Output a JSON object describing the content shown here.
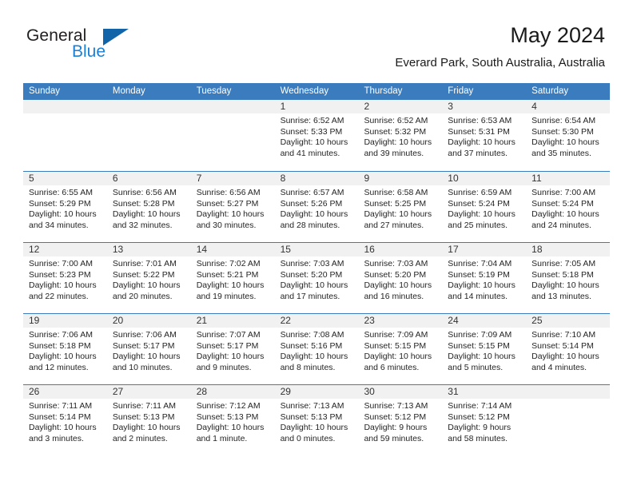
{
  "brand": {
    "name_part1": "General",
    "name_part2": "Blue",
    "triangle_color": "#1264a8",
    "blue_text_color": "#1b7fd4"
  },
  "header": {
    "title": "May 2024",
    "location": "Everard Park, South Australia, Australia"
  },
  "theme": {
    "header_band": "#3a7cbe",
    "day_band": "#f1f1f1",
    "text": "#1a1a1a"
  },
  "weekdays": [
    "Sunday",
    "Monday",
    "Tuesday",
    "Wednesday",
    "Thursday",
    "Friday",
    "Saturday"
  ],
  "weeks": [
    [
      {
        "day": "",
        "sunrise": "",
        "sunset": "",
        "daylight_line1": "",
        "daylight_line2": ""
      },
      {
        "day": "",
        "sunrise": "",
        "sunset": "",
        "daylight_line1": "",
        "daylight_line2": ""
      },
      {
        "day": "",
        "sunrise": "",
        "sunset": "",
        "daylight_line1": "",
        "daylight_line2": ""
      },
      {
        "day": "1",
        "sunrise": "Sunrise: 6:52 AM",
        "sunset": "Sunset: 5:33 PM",
        "daylight_line1": "Daylight: 10 hours",
        "daylight_line2": "and 41 minutes."
      },
      {
        "day": "2",
        "sunrise": "Sunrise: 6:52 AM",
        "sunset": "Sunset: 5:32 PM",
        "daylight_line1": "Daylight: 10 hours",
        "daylight_line2": "and 39 minutes."
      },
      {
        "day": "3",
        "sunrise": "Sunrise: 6:53 AM",
        "sunset": "Sunset: 5:31 PM",
        "daylight_line1": "Daylight: 10 hours",
        "daylight_line2": "and 37 minutes."
      },
      {
        "day": "4",
        "sunrise": "Sunrise: 6:54 AM",
        "sunset": "Sunset: 5:30 PM",
        "daylight_line1": "Daylight: 10 hours",
        "daylight_line2": "and 35 minutes."
      }
    ],
    [
      {
        "day": "5",
        "sunrise": "Sunrise: 6:55 AM",
        "sunset": "Sunset: 5:29 PM",
        "daylight_line1": "Daylight: 10 hours",
        "daylight_line2": "and 34 minutes."
      },
      {
        "day": "6",
        "sunrise": "Sunrise: 6:56 AM",
        "sunset": "Sunset: 5:28 PM",
        "daylight_line1": "Daylight: 10 hours",
        "daylight_line2": "and 32 minutes."
      },
      {
        "day": "7",
        "sunrise": "Sunrise: 6:56 AM",
        "sunset": "Sunset: 5:27 PM",
        "daylight_line1": "Daylight: 10 hours",
        "daylight_line2": "and 30 minutes."
      },
      {
        "day": "8",
        "sunrise": "Sunrise: 6:57 AM",
        "sunset": "Sunset: 5:26 PM",
        "daylight_line1": "Daylight: 10 hours",
        "daylight_line2": "and 28 minutes."
      },
      {
        "day": "9",
        "sunrise": "Sunrise: 6:58 AM",
        "sunset": "Sunset: 5:25 PM",
        "daylight_line1": "Daylight: 10 hours",
        "daylight_line2": "and 27 minutes."
      },
      {
        "day": "10",
        "sunrise": "Sunrise: 6:59 AM",
        "sunset": "Sunset: 5:24 PM",
        "daylight_line1": "Daylight: 10 hours",
        "daylight_line2": "and 25 minutes."
      },
      {
        "day": "11",
        "sunrise": "Sunrise: 7:00 AM",
        "sunset": "Sunset: 5:24 PM",
        "daylight_line1": "Daylight: 10 hours",
        "daylight_line2": "and 24 minutes."
      }
    ],
    [
      {
        "day": "12",
        "sunrise": "Sunrise: 7:00 AM",
        "sunset": "Sunset: 5:23 PM",
        "daylight_line1": "Daylight: 10 hours",
        "daylight_line2": "and 22 minutes."
      },
      {
        "day": "13",
        "sunrise": "Sunrise: 7:01 AM",
        "sunset": "Sunset: 5:22 PM",
        "daylight_line1": "Daylight: 10 hours",
        "daylight_line2": "and 20 minutes."
      },
      {
        "day": "14",
        "sunrise": "Sunrise: 7:02 AM",
        "sunset": "Sunset: 5:21 PM",
        "daylight_line1": "Daylight: 10 hours",
        "daylight_line2": "and 19 minutes."
      },
      {
        "day": "15",
        "sunrise": "Sunrise: 7:03 AM",
        "sunset": "Sunset: 5:20 PM",
        "daylight_line1": "Daylight: 10 hours",
        "daylight_line2": "and 17 minutes."
      },
      {
        "day": "16",
        "sunrise": "Sunrise: 7:03 AM",
        "sunset": "Sunset: 5:20 PM",
        "daylight_line1": "Daylight: 10 hours",
        "daylight_line2": "and 16 minutes."
      },
      {
        "day": "17",
        "sunrise": "Sunrise: 7:04 AM",
        "sunset": "Sunset: 5:19 PM",
        "daylight_line1": "Daylight: 10 hours",
        "daylight_line2": "and 14 minutes."
      },
      {
        "day": "18",
        "sunrise": "Sunrise: 7:05 AM",
        "sunset": "Sunset: 5:18 PM",
        "daylight_line1": "Daylight: 10 hours",
        "daylight_line2": "and 13 minutes."
      }
    ],
    [
      {
        "day": "19",
        "sunrise": "Sunrise: 7:06 AM",
        "sunset": "Sunset: 5:18 PM",
        "daylight_line1": "Daylight: 10 hours",
        "daylight_line2": "and 12 minutes."
      },
      {
        "day": "20",
        "sunrise": "Sunrise: 7:06 AM",
        "sunset": "Sunset: 5:17 PM",
        "daylight_line1": "Daylight: 10 hours",
        "daylight_line2": "and 10 minutes."
      },
      {
        "day": "21",
        "sunrise": "Sunrise: 7:07 AM",
        "sunset": "Sunset: 5:17 PM",
        "daylight_line1": "Daylight: 10 hours",
        "daylight_line2": "and 9 minutes."
      },
      {
        "day": "22",
        "sunrise": "Sunrise: 7:08 AM",
        "sunset": "Sunset: 5:16 PM",
        "daylight_line1": "Daylight: 10 hours",
        "daylight_line2": "and 8 minutes."
      },
      {
        "day": "23",
        "sunrise": "Sunrise: 7:09 AM",
        "sunset": "Sunset: 5:15 PM",
        "daylight_line1": "Daylight: 10 hours",
        "daylight_line2": "and 6 minutes."
      },
      {
        "day": "24",
        "sunrise": "Sunrise: 7:09 AM",
        "sunset": "Sunset: 5:15 PM",
        "daylight_line1": "Daylight: 10 hours",
        "daylight_line2": "and 5 minutes."
      },
      {
        "day": "25",
        "sunrise": "Sunrise: 7:10 AM",
        "sunset": "Sunset: 5:14 PM",
        "daylight_line1": "Daylight: 10 hours",
        "daylight_line2": "and 4 minutes."
      }
    ],
    [
      {
        "day": "26",
        "sunrise": "Sunrise: 7:11 AM",
        "sunset": "Sunset: 5:14 PM",
        "daylight_line1": "Daylight: 10 hours",
        "daylight_line2": "and 3 minutes."
      },
      {
        "day": "27",
        "sunrise": "Sunrise: 7:11 AM",
        "sunset": "Sunset: 5:13 PM",
        "daylight_line1": "Daylight: 10 hours",
        "daylight_line2": "and 2 minutes."
      },
      {
        "day": "28",
        "sunrise": "Sunrise: 7:12 AM",
        "sunset": "Sunset: 5:13 PM",
        "daylight_line1": "Daylight: 10 hours",
        "daylight_line2": "and 1 minute."
      },
      {
        "day": "29",
        "sunrise": "Sunrise: 7:13 AM",
        "sunset": "Sunset: 5:13 PM",
        "daylight_line1": "Daylight: 10 hours",
        "daylight_line2": "and 0 minutes."
      },
      {
        "day": "30",
        "sunrise": "Sunrise: 7:13 AM",
        "sunset": "Sunset: 5:12 PM",
        "daylight_line1": "Daylight: 9 hours",
        "daylight_line2": "and 59 minutes."
      },
      {
        "day": "31",
        "sunrise": "Sunrise: 7:14 AM",
        "sunset": "Sunset: 5:12 PM",
        "daylight_line1": "Daylight: 9 hours",
        "daylight_line2": "and 58 minutes."
      },
      {
        "day": "",
        "sunrise": "",
        "sunset": "",
        "daylight_line1": "",
        "daylight_line2": ""
      }
    ]
  ]
}
